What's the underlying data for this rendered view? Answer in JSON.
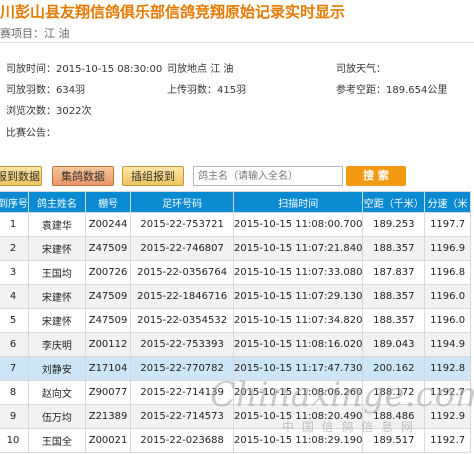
{
  "header": {
    "title": "川彭山县友翔信鸽俱乐部信鸽竞翔原始记录实时显示",
    "project_label": "赛项目：",
    "project_value": "江 油"
  },
  "info": {
    "release_time_label": "司放时间：",
    "release_time": "2015-10-15 08:30:00",
    "release_place_label": "司放地点",
    "release_place": "江 油",
    "weather_label": "司放天气：",
    "weather": "",
    "feather_count_label": "司放羽数：",
    "feather_count": "634羽",
    "upload_count_label": "上传羽数：",
    "upload_count": "415羽",
    "distance_label": "参考空距：",
    "distance": "189.654公里",
    "views_label": "浏览次数：",
    "views": "3022次",
    "notice_label": "比赛公告：",
    "notice": ""
  },
  "toolbar": {
    "btn_arrival": "报到数据",
    "btn_group": "集鸽数据",
    "btn_insert": "插组报到",
    "search_placeholder": "鸽主名（请输入全名）",
    "search_button": "搜 索"
  },
  "table": {
    "headers": [
      "到序号",
      "鸽主姓名",
      "棚号",
      "足环号码",
      "扫描时间",
      "空距（千米）",
      "分速（米"
    ],
    "rows": [
      [
        "1",
        "袁建华",
        "Z00244",
        "2015-22-753721",
        "2015-10-15 11:08:00.700",
        "189.253",
        "1197.7"
      ],
      [
        "2",
        "宋建怀",
        "Z47509",
        "2015-22-746807",
        "2015-10-15 11:07:21.840",
        "188.357",
        "1196.9"
      ],
      [
        "3",
        "王国均",
        "Z00726",
        "2015-22-0356764",
        "2015-10-15 11:07:33.080",
        "187.837",
        "1196.8"
      ],
      [
        "4",
        "宋建怀",
        "Z47509",
        "2015-22-1846716",
        "2015-10-15 11:07:29.130",
        "188.357",
        "1196.0"
      ],
      [
        "5",
        "宋建怀",
        "Z47509",
        "2015-22-0354532",
        "2015-10-15 11:07:34.820",
        "188.357",
        "1196.0"
      ],
      [
        "6",
        "李庆明",
        "Z00112",
        "2015-22-753393",
        "2015-10-15 11:08:16.020",
        "189.043",
        "1194.9"
      ],
      [
        "7",
        "刘静安",
        "Z17104",
        "2015-22-770782",
        "2015-10-15 11:17:47.730",
        "200.162",
        "1192.8"
      ],
      [
        "8",
        "赵向文",
        "Z90077",
        "2015-22-714139",
        "2015-10-15 11:08:06.260",
        "188.172",
        "1192.7"
      ],
      [
        "9",
        "伍万均",
        "Z21389",
        "2015-22-714573",
        "2015-10-15 11:08:20.490",
        "188.486",
        "1192.9"
      ],
      [
        "10",
        "王国全",
        "Z00021",
        "2015-22-023688",
        "2015-10-15 11:08:29.190",
        "189.517",
        "1192.7"
      ]
    ]
  },
  "watermark": {
    "text": "Chinaxinge.com",
    "subtext": "中 国 信 鸽 信 息 网"
  }
}
